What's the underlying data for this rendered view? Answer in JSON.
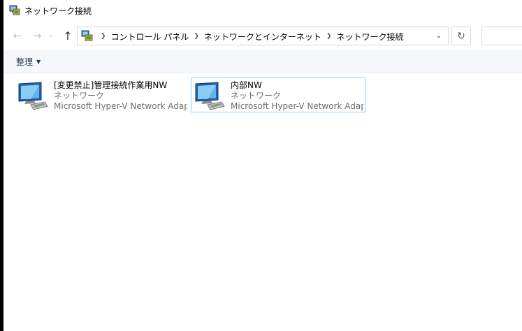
{
  "window": {
    "title": "ネットワーク接続"
  },
  "nav": {
    "back_icon": "arrow-left-icon",
    "forward_icon": "arrow-right-icon",
    "up_icon": "arrow-up-icon",
    "refresh_icon": "refresh-icon"
  },
  "breadcrumbs": [
    {
      "label": "コントロール パネル"
    },
    {
      "label": "ネットワークとインターネット"
    },
    {
      "label": "ネットワーク接続"
    }
  ],
  "toolbar": {
    "organize_label": "整理"
  },
  "connections": [
    {
      "name": "[変更禁止]管理接続作業用NW",
      "status": "ネットワーク",
      "adapter": "Microsoft Hyper-V Network Adapter",
      "selected": false
    },
    {
      "name": "内部NW",
      "status": "ネットワーク",
      "adapter": "Microsoft Hyper-V Network Adapter",
      "selected": true
    }
  ],
  "colors": {
    "selection_border": "#99d1f3",
    "command_bar_bg": "#f5f7fa"
  }
}
